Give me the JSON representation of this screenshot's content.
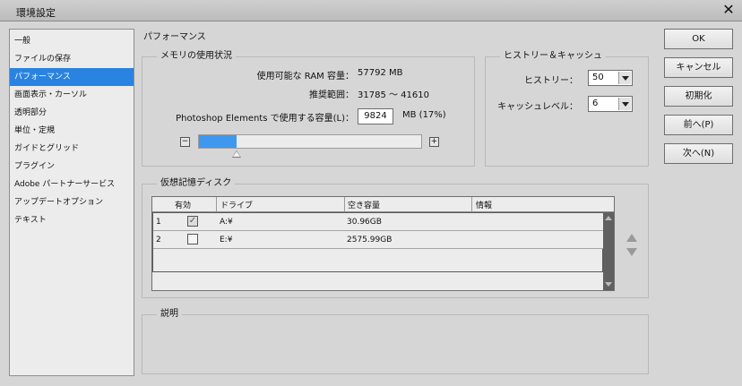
{
  "window": {
    "title": "環境設定"
  },
  "sidebar": {
    "items": [
      {
        "label": "一般"
      },
      {
        "label": "ファイルの保存"
      },
      {
        "label": "パフォーマンス"
      },
      {
        "label": "画面表示・カーソル"
      },
      {
        "label": "透明部分"
      },
      {
        "label": "単位・定規"
      },
      {
        "label": "ガイドとグリッド"
      },
      {
        "label": "プラグイン"
      },
      {
        "label": "Adobe パートナーサービス"
      },
      {
        "label": "アップデートオプション"
      },
      {
        "label": "テキスト"
      }
    ],
    "selected_index": 2
  },
  "section": {
    "title": "パフォーマンス"
  },
  "memory": {
    "legend": "メモリの使用状況",
    "available_label": "使用可能な RAM 容量：",
    "available_value": "57792 MB",
    "range_label": "推奨範囲：",
    "range_value": "31785 〜 41610",
    "usage_label": "Photoshop Elements で使用する容量(L)：",
    "usage_value": "9824",
    "usage_unit": "MB (17%)",
    "minus": "−",
    "plus": "+",
    "slider_fraction": 0.17
  },
  "history": {
    "legend": "ヒストリー＆キャッシュ",
    "history_label": "ヒストリー：",
    "history_value": "50",
    "cache_label": "キャッシュレベル：",
    "cache_value": "6"
  },
  "vdisk": {
    "legend": "仮想記憶ディスク",
    "headers": {
      "enabled": "有効",
      "drive": "ドライブ",
      "free": "空き容量",
      "info": "情報"
    },
    "rows": [
      {
        "num": "1",
        "enabled": true,
        "check": "✓",
        "drive": "A:¥",
        "free": "30.96GB",
        "info": ""
      },
      {
        "num": "2",
        "enabled": false,
        "check": "",
        "drive": "E:¥",
        "free": "2575.99GB",
        "info": ""
      }
    ]
  },
  "description": {
    "legend": "説明"
  },
  "buttons": {
    "ok": "OK",
    "cancel": "キャンセル",
    "reset": "初期化",
    "prev": "前へ(P)",
    "next": "次へ(N)"
  },
  "colors": {
    "accent": "#2a83e0",
    "slider_fill": "#3f97ee"
  }
}
